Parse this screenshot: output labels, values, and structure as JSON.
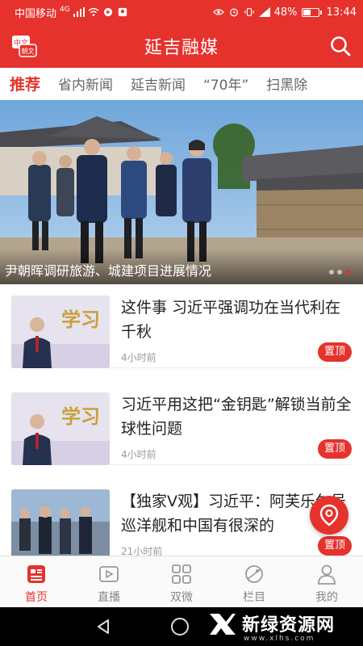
{
  "status_bar": {
    "carrier": "中国移动",
    "network": "4G",
    "battery": "48%",
    "time": "13:44"
  },
  "header": {
    "title": "延吉融媒",
    "logo_text_top": "中文",
    "logo_text_bottom": "朝文"
  },
  "tabs": [
    {
      "label": "推荐",
      "active": true
    },
    {
      "label": "省内新闻",
      "active": false
    },
    {
      "label": "延吉新闻",
      "active": false
    },
    {
      "label": "“70年”",
      "active": false
    },
    {
      "label": "扫黑除",
      "active": false
    }
  ],
  "banner": {
    "caption": "尹朝晖调研旅游、城建项目进展情况"
  },
  "feed": [
    {
      "title": "这件事 习近平强调功在当代利在千秋",
      "time": "4小时前",
      "badge": "置顶",
      "thumb_text": "学习"
    },
    {
      "title": "习近平用这把“金钥匙”解锁当前全球性问题",
      "time": "4小时前",
      "badge": "置顶",
      "thumb_text": "学习"
    },
    {
      "title": "【独家V观】习近平：阿芙乐尔号巡洋舰和中国有很深的",
      "time": "21小时前",
      "badge": "置顶",
      "thumb_text": ""
    }
  ],
  "bottom_nav": [
    {
      "label": "首页",
      "icon": "news-icon",
      "active": true
    },
    {
      "label": "直播",
      "icon": "live-icon",
      "active": false
    },
    {
      "label": "双微",
      "icon": "grid-icon",
      "active": false
    },
    {
      "label": "栏目",
      "icon": "planet-icon",
      "active": false
    },
    {
      "label": "我的",
      "icon": "user-icon",
      "active": false
    }
  ],
  "watermark": {
    "text": "新绿资源网",
    "url": "www.xlhs.com"
  },
  "colors": {
    "accent": "#e5322d"
  }
}
